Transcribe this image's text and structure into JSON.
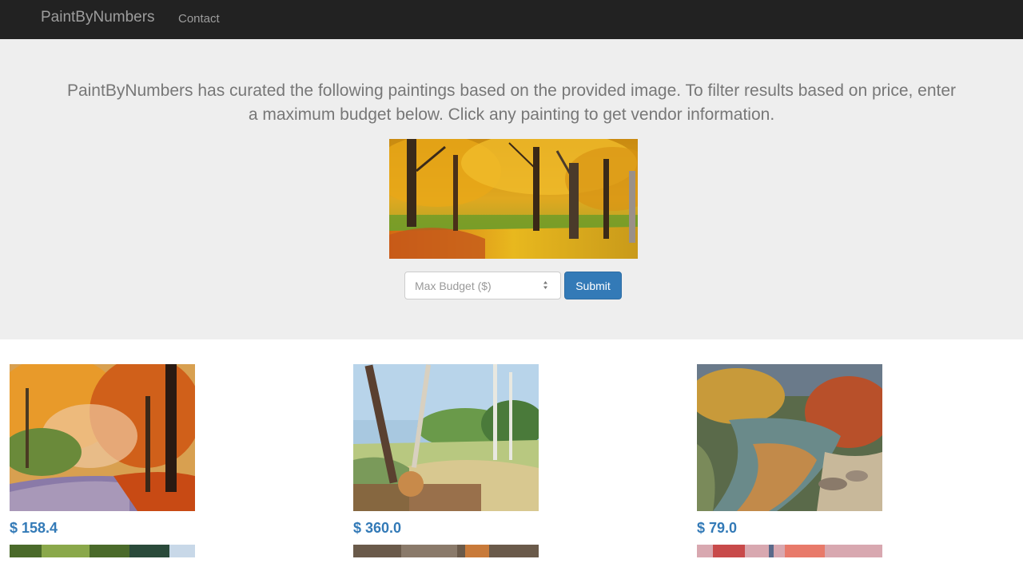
{
  "navbar": {
    "brand": "PaintByNumbers",
    "links": [
      "Contact"
    ],
    "bg_color": "#222222"
  },
  "intro": {
    "text": "PaintByNumbers has curated the following paintings based on the provided image. To filter results based on price, enter a maximum budget below. Click any painting to get vendor information."
  },
  "hero": {
    "subject": "autumn forest painting"
  },
  "filter": {
    "budget_placeholder": "Max Budget ($)",
    "submit_label": "Submit",
    "accent": "#337ab7"
  },
  "paintings": [
    {
      "price": "$ 158.4",
      "subject": "autumn road painting"
    },
    {
      "price": "$ 360.0",
      "subject": "birch trees and logs painting"
    },
    {
      "price": "$ 79.0",
      "subject": "autumn river painting"
    }
  ],
  "next_row": [
    {
      "subject": "green foliage painting"
    },
    {
      "subject": "forest painting"
    },
    {
      "subject": "red autumn painting"
    }
  ]
}
